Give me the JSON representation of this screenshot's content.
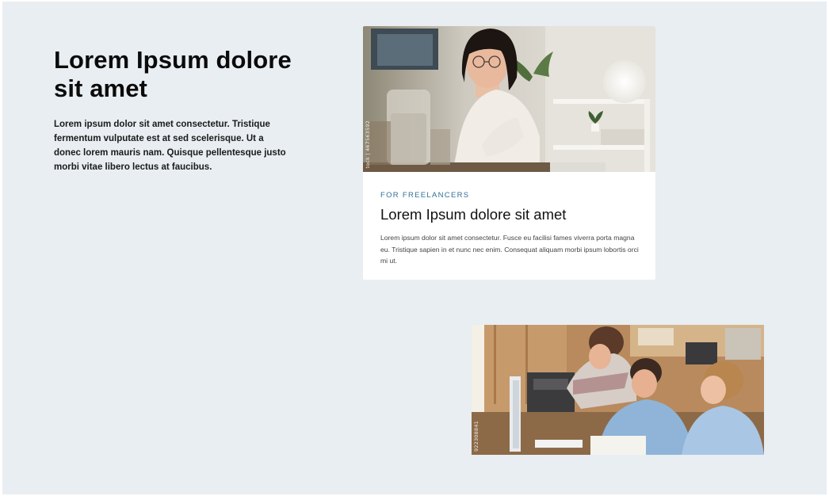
{
  "intro": {
    "title": "Lorem Ipsum dolore sit amet",
    "description": "Lorem ipsum dolor sit amet consectetur. Tristique fermentum vulputate est at sed scelerisque. Ut a donec lorem mauris nam. Quisque pellentesque justo morbi vitae libero lectus at faucibus."
  },
  "card": {
    "eyebrow": "FOR FREELANCERS",
    "title": "Lorem Ipsum dolore sit amet",
    "description": "Lorem ipsum dolor sit amet consectetur. Fusce eu facilisi fames viverra porta magna eu. Tristique sapien in et nunc nec enim. Consequat aliquam morbi ipsum lobortis orci mi ut.",
    "photo_credit": "tock | 467563592"
  },
  "photo2": {
    "photo_credit": "922308841"
  },
  "colors": {
    "background": "#e8eef1",
    "accent": "#2f6f94",
    "text": "#0b0b0b"
  }
}
